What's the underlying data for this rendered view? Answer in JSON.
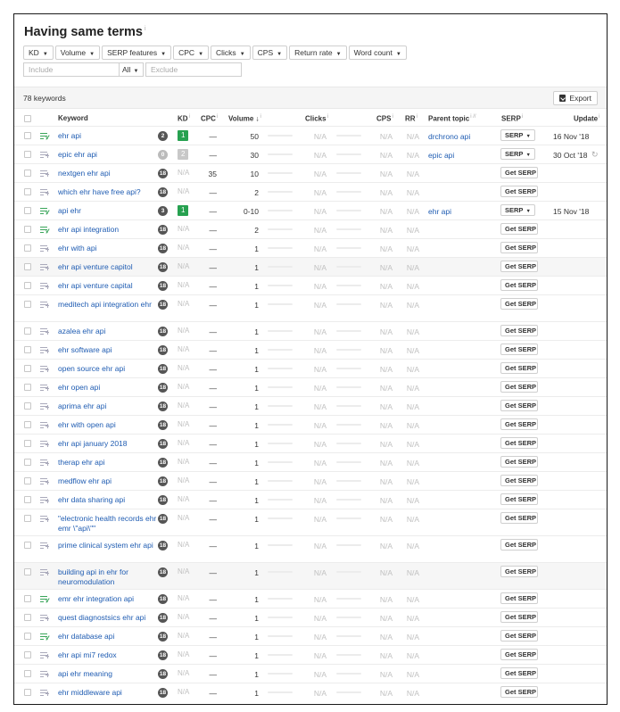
{
  "title": "Having same terms",
  "title_info": "i",
  "filters": [
    {
      "label": "KD",
      "icon": "caret-down-icon"
    },
    {
      "label": "Volume",
      "icon": "caret-down-icon"
    },
    {
      "label": "SERP features",
      "icon": "caret-down-icon"
    },
    {
      "label": "CPC",
      "icon": "caret-down-icon"
    },
    {
      "label": "Clicks",
      "icon": "caret-down-icon"
    },
    {
      "label": "CPS",
      "icon": "caret-down-icon"
    },
    {
      "label": "Return rate",
      "icon": "caret-down-icon"
    },
    {
      "label": "Word count",
      "icon": "caret-down-icon"
    }
  ],
  "search": {
    "include_placeholder": "Include",
    "scope_value": "All",
    "exclude_placeholder": "Exclude"
  },
  "summary": {
    "count": "78 keywords",
    "export_label": "Export",
    "export_icon": "export-icon"
  },
  "columns": {
    "keyword": "Keyword",
    "kd": "KD",
    "cpc": "CPC",
    "volume": "Volume",
    "clicks": "Clicks",
    "cps": "CPS",
    "rr": "RR",
    "parent": "Parent topic",
    "serp": "SERP",
    "update": "Update",
    "info": "i",
    "parent_info": "i //",
    "volume_sort": "↓"
  },
  "colors": {
    "link": "#1f5cb2",
    "kd_green": "#27a150",
    "kd_gray": "#c8c8c8",
    "na": "#c0c0c0"
  },
  "rows": [
    {
      "keyword": "ehr api",
      "icon": "list-check-icon",
      "badge": "2",
      "kd": "1",
      "kdstyle": "g",
      "cpc": "—",
      "volume": "50",
      "clicks": "N/A",
      "cps": "N/A",
      "rr": "N/A",
      "parent": "drchrono api",
      "serp": "SERP",
      "serptype": "dd",
      "update": "16 Nov '18",
      "h": 21,
      "hl": false,
      "refresh": false
    },
    {
      "keyword": "epic ehr api",
      "icon": "list-add-icon",
      "badge": "0",
      "badgelight": true,
      "kd": "2",
      "kdstyle": "gr",
      "cpc": "—",
      "volume": "30",
      "clicks": "N/A",
      "cps": "N/A",
      "rr": "N/A",
      "parent": "epic api",
      "serp": "SERP",
      "serptype": "dd",
      "update": "30 Oct '18",
      "h": 21,
      "hl": false,
      "refresh": true
    },
    {
      "keyword": "nextgen ehr api",
      "icon": "list-add-icon",
      "badge": "18",
      "kd": "N/A",
      "kdstyle": "na",
      "cpc": "35",
      "volume": "10",
      "clicks": "N/A",
      "cps": "N/A",
      "rr": "N/A",
      "parent": "",
      "serp": "Get SERP",
      "serptype": "get",
      "update": "",
      "h": 21,
      "hl": false,
      "refresh": false
    },
    {
      "keyword": "which ehr have free api?",
      "icon": "list-add-icon",
      "badge": "18",
      "kd": "N/A",
      "kdstyle": "na",
      "cpc": "—",
      "volume": "2",
      "clicks": "N/A",
      "cps": "N/A",
      "rr": "N/A",
      "parent": "",
      "serp": "Get SERP",
      "serptype": "get",
      "update": "",
      "h": 21,
      "hl": false,
      "refresh": false
    },
    {
      "keyword": "api ehr",
      "icon": "list-check-icon",
      "badge": "3",
      "kd": "1",
      "kdstyle": "g",
      "cpc": "—",
      "volume": "0-10",
      "clicks": "N/A",
      "cps": "N/A",
      "rr": "N/A",
      "parent": "ehr api",
      "serp": "SERP",
      "serptype": "dd",
      "update": "15 Nov '18",
      "h": 21,
      "hl": false,
      "refresh": false
    },
    {
      "keyword": "ehr api integration",
      "icon": "list-check-icon",
      "badge": "18",
      "kd": "N/A",
      "kdstyle": "na",
      "cpc": "—",
      "volume": "2",
      "clicks": "N/A",
      "cps": "N/A",
      "rr": "N/A",
      "parent": "",
      "serp": "Get SERP",
      "serptype": "get",
      "update": "",
      "h": 21,
      "hl": false,
      "refresh": false
    },
    {
      "keyword": "ehr with api",
      "icon": "list-add-icon",
      "badge": "18",
      "kd": "N/A",
      "kdstyle": "na",
      "cpc": "—",
      "volume": "1",
      "clicks": "N/A",
      "cps": "N/A",
      "rr": "N/A",
      "parent": "",
      "serp": "Get SERP",
      "serptype": "get",
      "update": "",
      "h": 21,
      "hl": false,
      "refresh": false
    },
    {
      "keyword": "ehr api venture capitol",
      "icon": "list-add-icon",
      "badge": "18",
      "kd": "N/A",
      "kdstyle": "na",
      "cpc": "—",
      "volume": "1",
      "clicks": "N/A",
      "cps": "N/A",
      "rr": "N/A",
      "parent": "",
      "serp": "Get SERP",
      "serptype": "get",
      "update": "",
      "h": 21,
      "hl": true,
      "refresh": false
    },
    {
      "keyword": "ehr api venture capital",
      "icon": "list-add-icon",
      "badge": "18",
      "kd": "N/A",
      "kdstyle": "na",
      "cpc": "—",
      "volume": "1",
      "clicks": "N/A",
      "cps": "N/A",
      "rr": "N/A",
      "parent": "",
      "serp": "Get SERP",
      "serptype": "get",
      "update": "",
      "h": 21,
      "hl": false,
      "refresh": false
    },
    {
      "keyword": "meditech api integration ehr",
      "icon": "list-add-icon",
      "badge": "18",
      "kd": "N/A",
      "kdstyle": "na",
      "cpc": "—",
      "volume": "1",
      "clicks": "N/A",
      "cps": "N/A",
      "rr": "N/A",
      "parent": "",
      "serp": "Get SERP",
      "serptype": "get",
      "update": "",
      "h": 30,
      "hl": false,
      "refresh": false
    },
    {
      "keyword": "azalea ehr api",
      "icon": "list-add-icon",
      "badge": "18",
      "kd": "N/A",
      "kdstyle": "na",
      "cpc": "—",
      "volume": "1",
      "clicks": "N/A",
      "cps": "N/A",
      "rr": "N/A",
      "parent": "",
      "serp": "Get SERP",
      "serptype": "get",
      "update": "",
      "h": 21,
      "hl": false,
      "refresh": false
    },
    {
      "keyword": "ehr software api",
      "icon": "list-add-icon",
      "badge": "18",
      "kd": "N/A",
      "kdstyle": "na",
      "cpc": "—",
      "volume": "1",
      "clicks": "N/A",
      "cps": "N/A",
      "rr": "N/A",
      "parent": "",
      "serp": "Get SERP",
      "serptype": "get",
      "update": "",
      "h": 21,
      "hl": false,
      "refresh": false
    },
    {
      "keyword": "open source ehr api",
      "icon": "list-add-icon",
      "badge": "18",
      "kd": "N/A",
      "kdstyle": "na",
      "cpc": "—",
      "volume": "1",
      "clicks": "N/A",
      "cps": "N/A",
      "rr": "N/A",
      "parent": "",
      "serp": "Get SERP",
      "serptype": "get",
      "update": "",
      "h": 21,
      "hl": false,
      "refresh": false
    },
    {
      "keyword": "ehr open api",
      "icon": "list-add-icon",
      "badge": "18",
      "kd": "N/A",
      "kdstyle": "na",
      "cpc": "—",
      "volume": "1",
      "clicks": "N/A",
      "cps": "N/A",
      "rr": "N/A",
      "parent": "",
      "serp": "Get SERP",
      "serptype": "get",
      "update": "",
      "h": 21,
      "hl": false,
      "refresh": false
    },
    {
      "keyword": "aprima ehr api",
      "icon": "list-add-icon",
      "badge": "18",
      "kd": "N/A",
      "kdstyle": "na",
      "cpc": "—",
      "volume": "1",
      "clicks": "N/A",
      "cps": "N/A",
      "rr": "N/A",
      "parent": "",
      "serp": "Get SERP",
      "serptype": "get",
      "update": "",
      "h": 21,
      "hl": false,
      "refresh": false
    },
    {
      "keyword": "ehr with open api",
      "icon": "list-add-icon",
      "badge": "18",
      "kd": "N/A",
      "kdstyle": "na",
      "cpc": "—",
      "volume": "1",
      "clicks": "N/A",
      "cps": "N/A",
      "rr": "N/A",
      "parent": "",
      "serp": "Get SERP",
      "serptype": "get",
      "update": "",
      "h": 21,
      "hl": false,
      "refresh": false
    },
    {
      "keyword": "ehr api january 2018",
      "icon": "list-add-icon",
      "badge": "18",
      "kd": "N/A",
      "kdstyle": "na",
      "cpc": "—",
      "volume": "1",
      "clicks": "N/A",
      "cps": "N/A",
      "rr": "N/A",
      "parent": "",
      "serp": "Get SERP",
      "serptype": "get",
      "update": "",
      "h": 21,
      "hl": false,
      "refresh": false
    },
    {
      "keyword": "therap ehr api",
      "icon": "list-add-icon",
      "badge": "18",
      "kd": "N/A",
      "kdstyle": "na",
      "cpc": "—",
      "volume": "1",
      "clicks": "N/A",
      "cps": "N/A",
      "rr": "N/A",
      "parent": "",
      "serp": "Get SERP",
      "serptype": "get",
      "update": "",
      "h": 21,
      "hl": false,
      "refresh": false
    },
    {
      "keyword": "medflow ehr api",
      "icon": "list-add-icon",
      "badge": "18",
      "kd": "N/A",
      "kdstyle": "na",
      "cpc": "—",
      "volume": "1",
      "clicks": "N/A",
      "cps": "N/A",
      "rr": "N/A",
      "parent": "",
      "serp": "Get SERP",
      "serptype": "get",
      "update": "",
      "h": 21,
      "hl": false,
      "refresh": false
    },
    {
      "keyword": "ehr data sharing api",
      "icon": "list-add-icon",
      "badge": "18",
      "kd": "N/A",
      "kdstyle": "na",
      "cpc": "—",
      "volume": "1",
      "clicks": "N/A",
      "cps": "N/A",
      "rr": "N/A",
      "parent": "",
      "serp": "Get SERP",
      "serptype": "get",
      "update": "",
      "h": 21,
      "hl": false,
      "refresh": false
    },
    {
      "keyword": "\"electronic health records ehr emr \\\"api\\\"\"",
      "icon": "list-add-icon",
      "badge": "18",
      "kd": "N/A",
      "kdstyle": "na",
      "cpc": "—",
      "volume": "1",
      "clicks": "N/A",
      "cps": "N/A",
      "rr": "N/A",
      "parent": "",
      "serp": "Get SERP",
      "serptype": "get",
      "update": "",
      "h": 30,
      "hl": false,
      "refresh": false
    },
    {
      "keyword": "prime clinical system ehr api",
      "icon": "list-add-icon",
      "badge": "18",
      "kd": "N/A",
      "kdstyle": "na",
      "cpc": "—",
      "volume": "1",
      "clicks": "N/A",
      "cps": "N/A",
      "rr": "N/A",
      "parent": "",
      "serp": "Get SERP",
      "serptype": "get",
      "update": "",
      "h": 30,
      "hl": false,
      "refresh": false
    },
    {
      "keyword": "building api in ehr for neuromodulation",
      "icon": "list-add-icon",
      "badge": "18",
      "kd": "N/A",
      "kdstyle": "na",
      "cpc": "—",
      "volume": "1",
      "clicks": "N/A",
      "cps": "N/A",
      "rr": "N/A",
      "parent": "",
      "serp": "Get SERP",
      "serptype": "get",
      "update": "",
      "h": 30,
      "hl": true,
      "refresh": false
    },
    {
      "keyword": "emr ehr integration api",
      "icon": "list-check-icon",
      "badge": "18",
      "kd": "N/A",
      "kdstyle": "na",
      "cpc": "—",
      "volume": "1",
      "clicks": "N/A",
      "cps": "N/A",
      "rr": "N/A",
      "parent": "",
      "serp": "Get SERP",
      "serptype": "get",
      "update": "",
      "h": 21,
      "hl": false,
      "refresh": false
    },
    {
      "keyword": "quest diagnostsics ehr api",
      "icon": "list-add-icon",
      "badge": "18",
      "kd": "N/A",
      "kdstyle": "na",
      "cpc": "—",
      "volume": "1",
      "clicks": "N/A",
      "cps": "N/A",
      "rr": "N/A",
      "parent": "",
      "serp": "Get SERP",
      "serptype": "get",
      "update": "",
      "h": 21,
      "hl": false,
      "refresh": false
    },
    {
      "keyword": "ehr database api",
      "icon": "list-check-icon",
      "badge": "18",
      "kd": "N/A",
      "kdstyle": "na",
      "cpc": "—",
      "volume": "1",
      "clicks": "N/A",
      "cps": "N/A",
      "rr": "N/A",
      "parent": "",
      "serp": "Get SERP",
      "serptype": "get",
      "update": "",
      "h": 21,
      "hl": false,
      "refresh": false
    },
    {
      "keyword": "ehr api mi7 redox",
      "icon": "list-add-icon",
      "badge": "18",
      "kd": "N/A",
      "kdstyle": "na",
      "cpc": "—",
      "volume": "1",
      "clicks": "N/A",
      "cps": "N/A",
      "rr": "N/A",
      "parent": "",
      "serp": "Get SERP",
      "serptype": "get",
      "update": "",
      "h": 21,
      "hl": false,
      "refresh": false
    },
    {
      "keyword": "api ehr meaning",
      "icon": "list-add-icon",
      "badge": "18",
      "kd": "N/A",
      "kdstyle": "na",
      "cpc": "—",
      "volume": "1",
      "clicks": "N/A",
      "cps": "N/A",
      "rr": "N/A",
      "parent": "",
      "serp": "Get SERP",
      "serptype": "get",
      "update": "",
      "h": 21,
      "hl": false,
      "refresh": false
    },
    {
      "keyword": "ehr middleware api",
      "icon": "list-add-icon",
      "badge": "18",
      "kd": "N/A",
      "kdstyle": "na",
      "cpc": "—",
      "volume": "1",
      "clicks": "N/A",
      "cps": "N/A",
      "rr": "N/A",
      "parent": "",
      "serp": "Get SERP",
      "serptype": "get",
      "update": "",
      "h": 21,
      "hl": false,
      "refresh": false
    }
  ]
}
